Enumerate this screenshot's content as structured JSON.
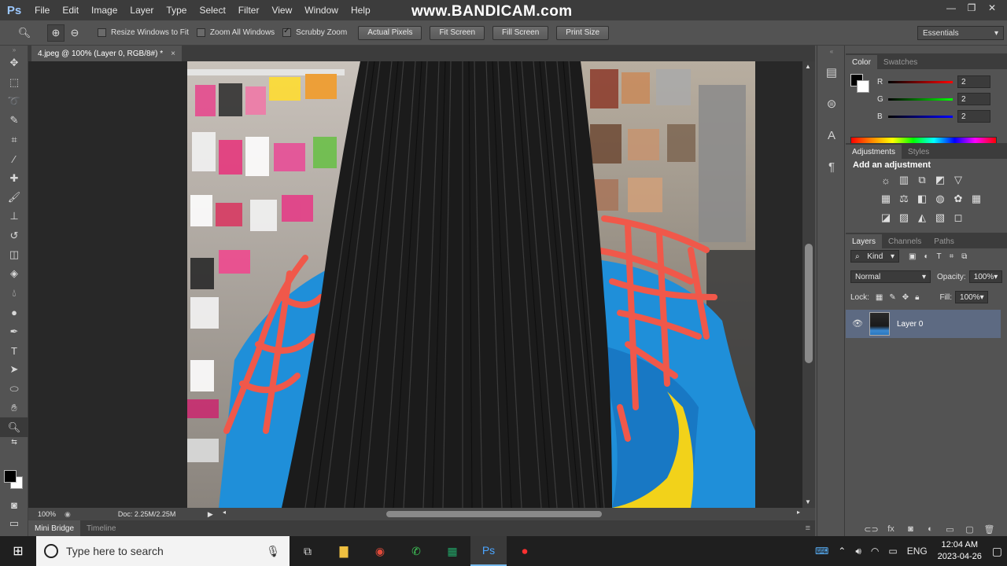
{
  "app": {
    "logo": "Ps"
  },
  "watermark": "www.BANDICAM.com",
  "menu": [
    "File",
    "Edit",
    "Image",
    "Layer",
    "Type",
    "Select",
    "Filter",
    "View",
    "Window",
    "Help"
  ],
  "options": {
    "resize_windows": "Resize Windows to Fit",
    "zoom_all_windows": "Zoom All Windows",
    "scrubby_zoom": "Scrubby Zoom",
    "actual_pixels": "Actual Pixels",
    "fit_screen": "Fit Screen",
    "fill_screen": "Fill Screen",
    "print_size": "Print Size",
    "workspace": "Essentials"
  },
  "document": {
    "tab_title": "4.jpeg @ 100% (Layer 0, RGB/8#) *",
    "zoom": "100%",
    "doc_size": "Doc: 2.25M/2.25M"
  },
  "bottom_tabs": {
    "mini_bridge": "Mini Bridge",
    "timeline": "Timeline"
  },
  "color_panel": {
    "tab_color": "Color",
    "tab_swatches": "Swatches",
    "r_label": "R",
    "r_value": "2",
    "g_label": "G",
    "g_value": "2",
    "b_label": "B",
    "b_value": "2",
    "colors": {
      "red": "#d01010",
      "green": "#10a010",
      "blue": "#1010d0"
    }
  },
  "adjustments_panel": {
    "tab_adjustments": "Adjustments",
    "tab_styles": "Styles",
    "title": "Add an adjustment"
  },
  "layers_panel": {
    "tab_layers": "Layers",
    "tab_channels": "Channels",
    "tab_paths": "Paths",
    "kind": "Kind",
    "blend_mode": "Normal",
    "opacity_label": "Opacity:",
    "opacity_value": "100%",
    "lock_label": "Lock:",
    "fill_label": "Fill:",
    "fill_value": "100%",
    "layer_name": "Layer 0"
  },
  "taskbar": {
    "search_placeholder": "Type here to search",
    "language": "ENG",
    "time": "12:04 AM",
    "date": "2023-04-26"
  }
}
